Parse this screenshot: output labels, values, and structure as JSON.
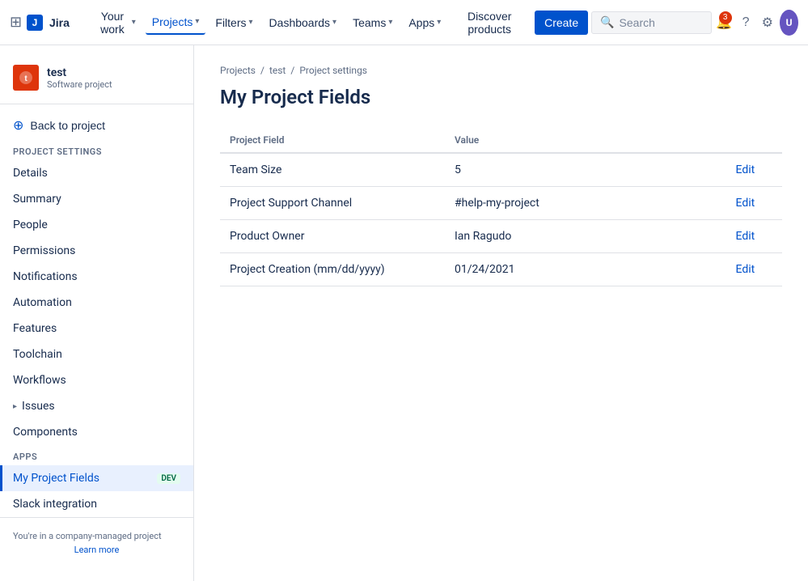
{
  "nav": {
    "logo_text": "Jira",
    "your_work_label": "Your work",
    "projects_label": "Projects",
    "filters_label": "Filters",
    "dashboards_label": "Dashboards",
    "teams_label": "Teams",
    "apps_label": "Apps",
    "discover_label": "Discover products",
    "create_label": "Create",
    "search_placeholder": "Search",
    "notifications_count": "3"
  },
  "sidebar": {
    "project_name": "test",
    "project_type": "Software project",
    "back_label": "Back to project",
    "section_label": "Project settings",
    "items": [
      {
        "label": "Details",
        "active": false
      },
      {
        "label": "Summary",
        "active": false
      },
      {
        "label": "People",
        "active": false
      },
      {
        "label": "Permissions",
        "active": false
      },
      {
        "label": "Notifications",
        "active": false
      },
      {
        "label": "Automation",
        "active": false
      },
      {
        "label": "Features",
        "active": false
      },
      {
        "label": "Toolchain",
        "active": false
      },
      {
        "label": "Workflows",
        "active": false
      }
    ],
    "expandable_items": [
      {
        "label": "Issues"
      },
      {
        "label": "Components"
      }
    ],
    "apps_section": "Apps",
    "apps_items": [
      {
        "label": "My Project Fields",
        "badge": "DEV",
        "active": true
      },
      {
        "label": "Slack integration",
        "active": false
      }
    ],
    "footer_text": "You're in a company-managed project",
    "learn_more": "Learn more"
  },
  "breadcrumb": {
    "items": [
      "Projects",
      "test",
      "Project settings"
    ]
  },
  "page": {
    "title": "My Project Fields"
  },
  "table": {
    "col_field": "Project Field",
    "col_value": "Value",
    "col_action": "",
    "rows": [
      {
        "field": "Team Size",
        "value": "5",
        "action": "Edit"
      },
      {
        "field": "Project Support Channel",
        "value": "#help-my-project",
        "action": "Edit"
      },
      {
        "field": "Product Owner",
        "value": "Ian Ragudo",
        "action": "Edit"
      },
      {
        "field": "Project Creation (mm/dd/yyyy)",
        "value": "01/24/2021",
        "action": "Edit"
      }
    ]
  }
}
